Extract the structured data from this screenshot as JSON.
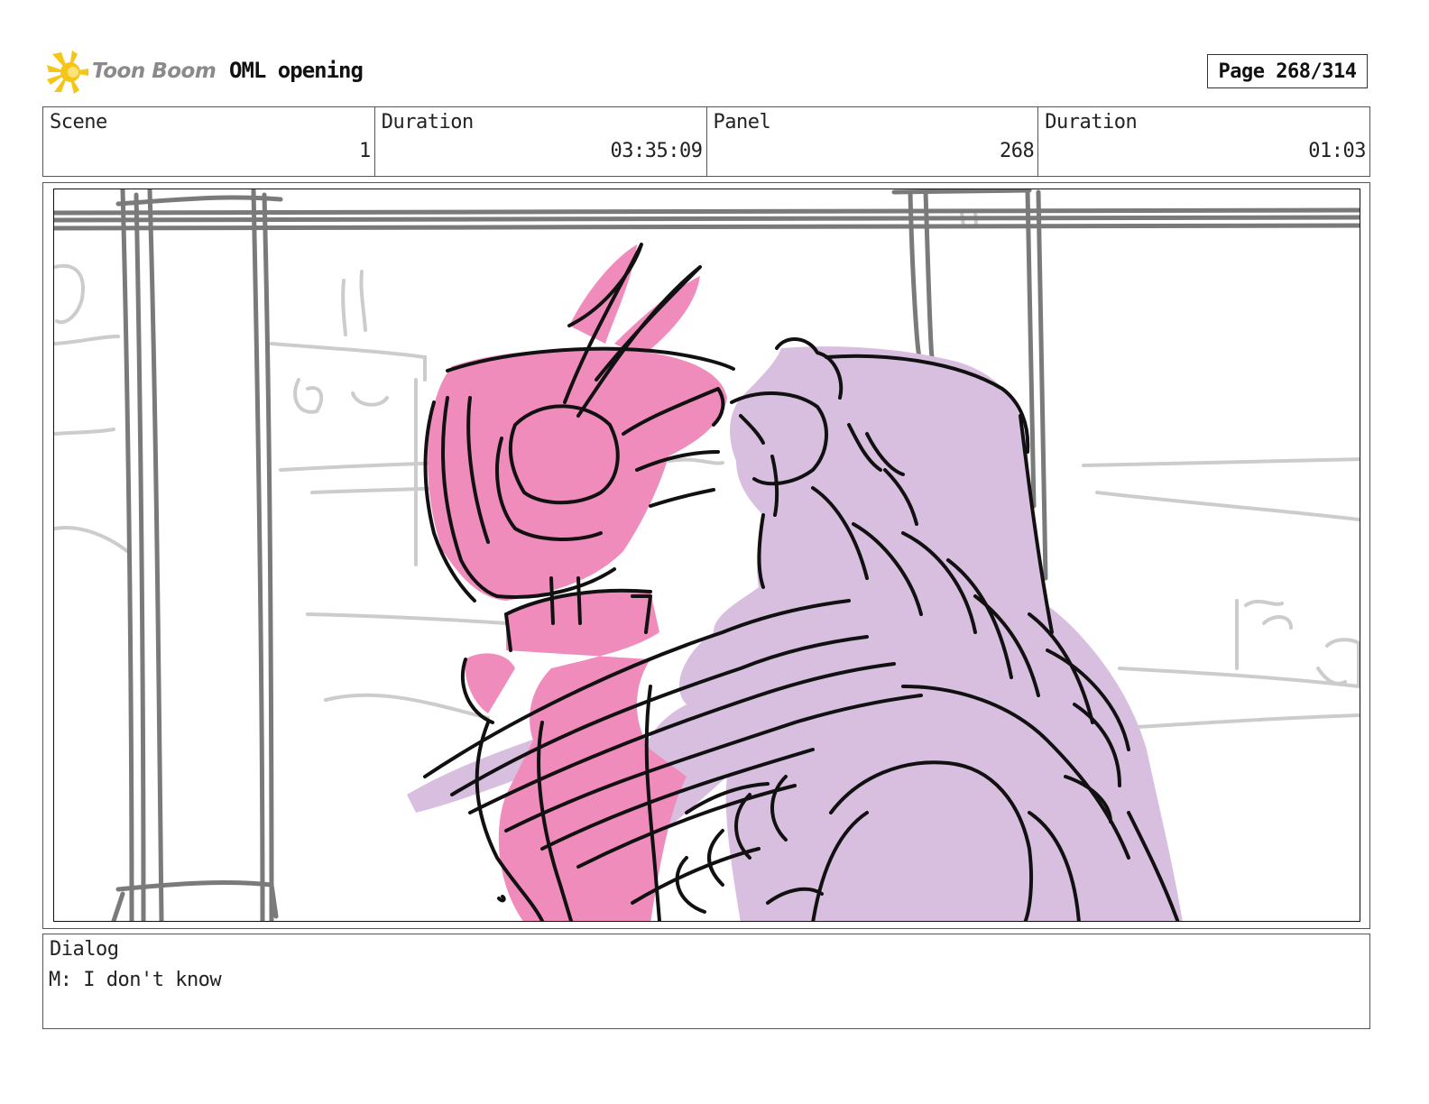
{
  "header": {
    "logo_text": "Toon Boom",
    "project_title": "OML opening",
    "page_label": "Page 268/314"
  },
  "info": {
    "scene_label": "Scene",
    "scene_value": "1",
    "scene_duration_label": "Duration",
    "scene_duration_value": "03:35:09",
    "panel_label": "Panel",
    "panel_value": "268",
    "panel_duration_label": "Duration",
    "panel_duration_value": "01:03"
  },
  "dialog": {
    "label": "Dialog",
    "text": "M: I don't know"
  },
  "colors": {
    "robot_fill": "#f08cbb",
    "girl_fill": "#d8bfe0",
    "background_lines": "#cccccc",
    "pillar_lines": "#7a7a7a",
    "logo_star": "#f5c518"
  }
}
